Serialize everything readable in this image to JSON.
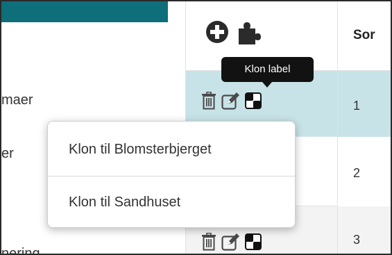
{
  "left_column": {
    "items": [
      "maer",
      "er",
      "nering"
    ]
  },
  "header": {
    "sort_label": "Sor",
    "icons": [
      "plus-circle-icon",
      "puzzle-icon"
    ]
  },
  "rows": [
    {
      "sort": "1",
      "icons": [
        "trash-icon",
        "edit-icon",
        "clone-icon"
      ]
    },
    {
      "sort": "2",
      "icons": []
    },
    {
      "sort": "3",
      "icons": [
        "trash-icon",
        "edit-icon",
        "clone-icon"
      ]
    }
  ],
  "tooltip": {
    "text": "Klon label"
  },
  "dropdown": {
    "items": [
      {
        "label": "Klon til Blomsterbjerget"
      },
      {
        "label": "Klon til Sandhuset"
      }
    ]
  },
  "colors": {
    "teal_bar": "#0e6e7a",
    "selected_row": "#c8e3e7",
    "tooltip_bg": "#121212",
    "alt_row": "#f3f3f3"
  }
}
